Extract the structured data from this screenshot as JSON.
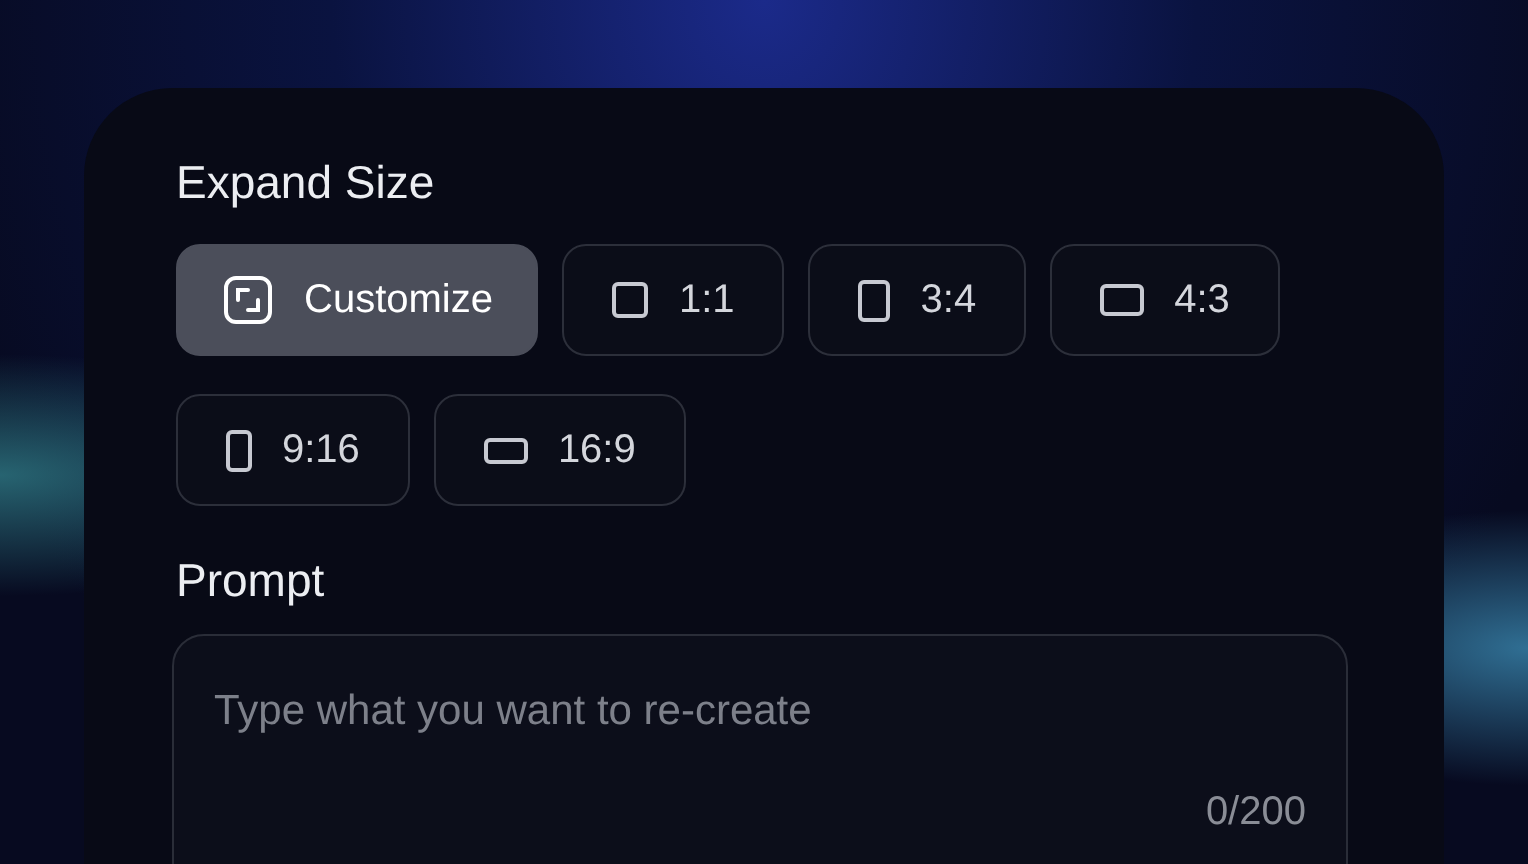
{
  "expand_size": {
    "title": "Expand Size",
    "options": [
      {
        "label": "Customize",
        "kind": "custom",
        "selected": true
      },
      {
        "label": "1:1",
        "kind": "square",
        "selected": false
      },
      {
        "label": "3:4",
        "kind": "portrait",
        "selected": false
      },
      {
        "label": "4:3",
        "kind": "landscape",
        "selected": false
      },
      {
        "label": "9:16",
        "kind": "tall",
        "selected": false
      },
      {
        "label": "16:9",
        "kind": "wide",
        "selected": false
      }
    ]
  },
  "prompt": {
    "title": "Prompt",
    "placeholder": "Type what you want to re-create",
    "counter": "0/200"
  }
}
